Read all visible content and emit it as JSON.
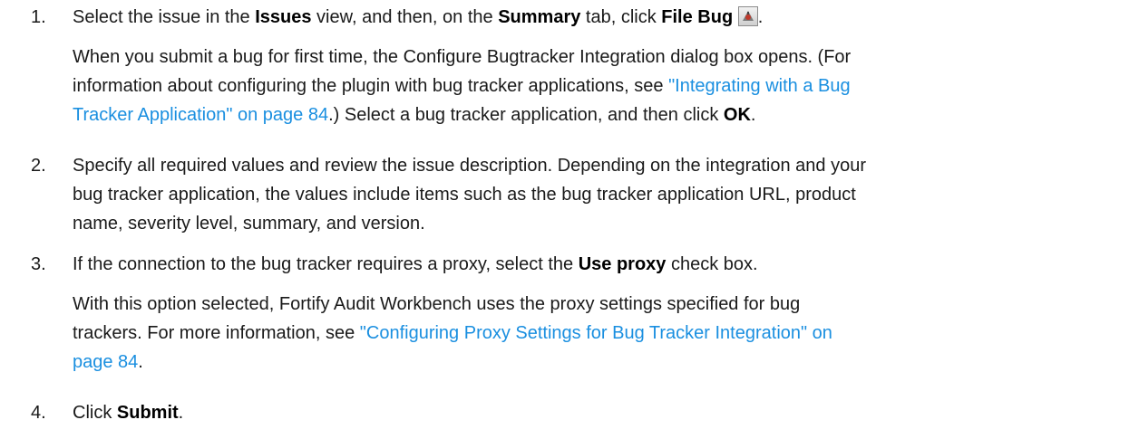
{
  "step1": {
    "number": "1.",
    "t1": "Select the issue in the ",
    "b1": "Issues",
    "t2": " view, and then, on the ",
    "b2": "Summary",
    "t3": " tab, click ",
    "b3": "File Bug",
    "icon": "file-bug-icon",
    "t4": ".",
    "p1": "When you submit a bug for first time, the Configure Bugtracker Integration dialog box opens. (For",
    "p2a": "information about configuring the plugin with bug tracker applications, see ",
    "link1a": "\"Integrating with a Bug",
    "link1b": "Tracker Application\" on page 84",
    "p3a": ".) Select a bug tracker application, and then click ",
    "p3b": "OK",
    "p3c": "."
  },
  "step2": {
    "number": "2.",
    "l1": "Specify all required values and review the issue description. Depending on the integration and your",
    "l2": "bug tracker application, the values include items such as the bug tracker application URL, product",
    "l3": "name, severity level, summary, and version."
  },
  "step3": {
    "number": "3.",
    "t1": "If the connection to the bug tracker requires a proxy, select the ",
    "b1": "Use proxy",
    "t2": " check box.",
    "p1": "With this option selected, Fortify Audit Workbench uses the proxy settings specified for bug",
    "p2a": "trackers. For more information, see ",
    "link2a": "\"Configuring Proxy Settings for Bug Tracker Integration\" on",
    "link2b": "page 84",
    "p3": "."
  },
  "step4": {
    "number": "4.",
    "t1": "Click ",
    "b1": "Submit",
    "t2": "."
  }
}
